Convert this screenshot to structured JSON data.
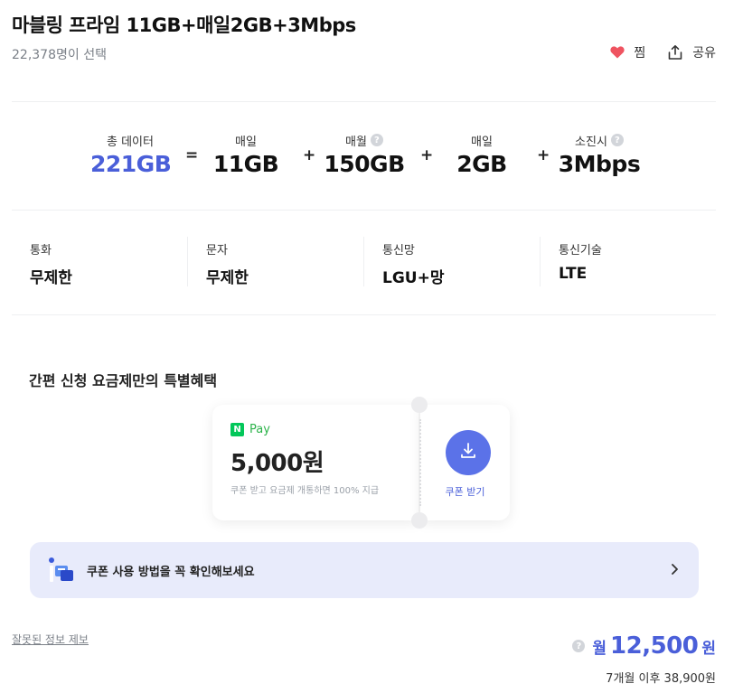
{
  "header": {
    "title": "마블링 프라임 11GB+매일2GB+3Mbps",
    "subtitle": "22,378명이 선택",
    "like_label": "찜",
    "share_label": "공유",
    "like_color": "#ef5360"
  },
  "data_summary": {
    "total": {
      "label": "총 데이터",
      "value": "221GB"
    },
    "monthly": {
      "label": "매일",
      "value": "11GB"
    },
    "monthly2": {
      "label": "매월",
      "value": "150GB"
    },
    "daily": {
      "label": "매일",
      "value": "2GB"
    },
    "exhausted": {
      "label": "소진시",
      "value": "3Mbps"
    },
    "op_eq": "=",
    "op_plus": "+"
  },
  "specs": [
    {
      "label": "통화",
      "value": "무제한"
    },
    {
      "label": "문자",
      "value": "무제한"
    },
    {
      "label": "통신망",
      "value": "LGU+망"
    },
    {
      "label": "통신기술",
      "value": "LTE"
    }
  ],
  "benefit": {
    "title": "간편 신청 요금제만의 특별혜택",
    "coupon": {
      "brand": "Pay",
      "brand_mark": "N",
      "amount": "5,000원",
      "desc": "쿠폰 받고 요금제 개통하면 100% 지급",
      "download_label": "쿠폰 받기"
    },
    "howto": "쿠폰 사용 방법을 꼭 확인해보세요"
  },
  "footer": {
    "report": "잘못된 정보 제보",
    "price_prefix": "월",
    "price_amount": "12,500",
    "price_suffix": "원",
    "after_price": "7개월 이후 38,900원"
  },
  "colors": {
    "accent": "#4a5fd9",
    "button": "#5b72e8",
    "naver_green": "#03c75a"
  }
}
